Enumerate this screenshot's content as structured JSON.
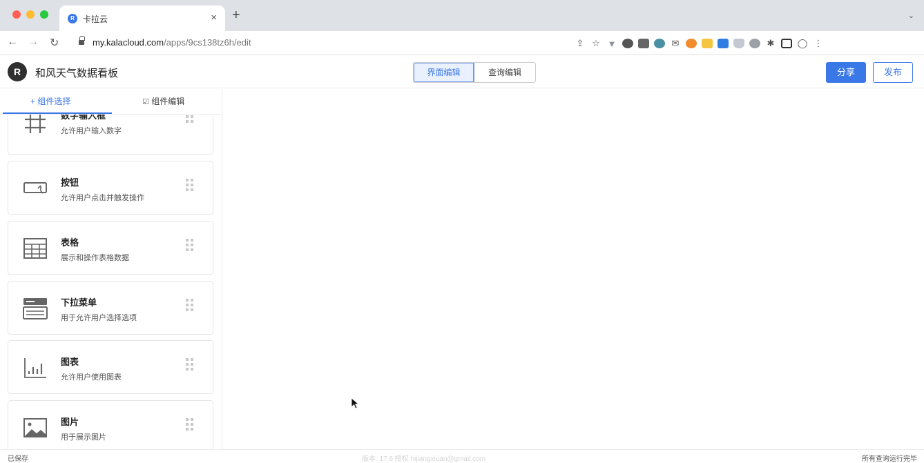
{
  "browser": {
    "tab_title": "卡拉云",
    "url_host": "my.kalacloud.com",
    "url_path": "/apps/9cs138tz6h/edit"
  },
  "app": {
    "logo_letter": "R",
    "title": "和风天气数据看板",
    "modes": [
      "界面编辑",
      "查询编辑"
    ],
    "share_label": "分享",
    "publish_label": "发布"
  },
  "sidebar": {
    "tabs": [
      "+ 组件选择",
      "组件编辑"
    ],
    "components": [
      {
        "name": "数字输入框",
        "desc": "允许用户输入数字",
        "icon": "hash-icon"
      },
      {
        "name": "按钮",
        "desc": "允许用户点击并触发操作",
        "icon": "button-icon"
      },
      {
        "name": "表格",
        "desc": "展示和操作表格数据",
        "icon": "table-icon"
      },
      {
        "name": "下拉菜单",
        "desc": "用于允许用户选择选项",
        "icon": "dropdown-icon"
      },
      {
        "name": "图表",
        "desc": "允许用户使用图表",
        "icon": "chart-icon"
      },
      {
        "name": "图片",
        "desc": "用于展示图片",
        "icon": "image-icon"
      }
    ]
  },
  "status": {
    "left": "已保存",
    "middle": "版本: 17.6 授权 hijiangxiuan@gmail.com",
    "right": "所有查询运行完毕"
  },
  "colors": {
    "accent": "#3b78e7"
  }
}
